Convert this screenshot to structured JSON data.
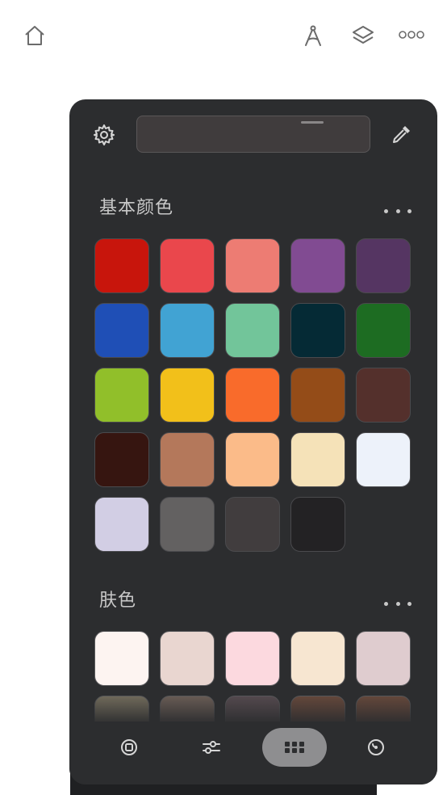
{
  "topbar": {
    "home_icon": "home-icon",
    "compass_icon": "compass-icon",
    "layers_icon": "layers-icon",
    "more_icon": "more-horizontal-icon"
  },
  "color_panel": {
    "settings_icon": "gear-icon",
    "eyedropper_icon": "eyedropper-icon",
    "basic_colors": {
      "title": "基本颜色",
      "swatches": [
        "#c8150c",
        "#ea474c",
        "#ed7c73",
        "#814b92",
        "#553562",
        "#1f4fb6",
        "#41a3d3",
        "#72c59a",
        "#052a35",
        "#1d6c22",
        "#91bf2a",
        "#f2c01a",
        "#f96b2b",
        "#944c18",
        "#54302c",
        "#361510",
        "#b4785b",
        "#fbbb89",
        "#f5e2b8",
        "#edf2fa",
        "#d2cee4",
        "#636161",
        "#413d3e",
        "#232224"
      ]
    },
    "skin_colors": {
      "title": "肤色",
      "swatches": [
        "#fdf4f1",
        "#e9d6d0",
        "#fcd9df",
        "#f7e6d1",
        "#dfcccf",
        "#77705f",
        "#6e6058",
        "#584c51",
        "#6a4a3c",
        "#6a4a3c"
      ]
    },
    "bottom_nav": [
      {
        "name": "layers-mode-icon",
        "active": false
      },
      {
        "name": "sliders-icon",
        "active": false
      },
      {
        "name": "grid-icon",
        "active": true
      },
      {
        "name": "color-wheel-icon",
        "active": false
      }
    ]
  }
}
